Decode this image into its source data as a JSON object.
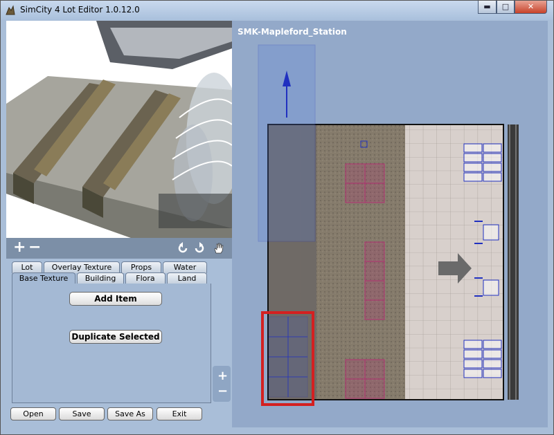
{
  "window": {
    "title": "SimCity 4 Lot Editor 1.0.12.0",
    "minimize_glyph": "▬",
    "maximize_glyph": "□",
    "close_glyph": "✕"
  },
  "toolbar": {
    "add_glyph": "+",
    "remove_glyph": "−",
    "icons": [
      "rotate-left-icon",
      "rotate-right-icon",
      "hand-pan-icon"
    ]
  },
  "tabs": {
    "row_top": [
      "Lot",
      "Overlay Texture",
      "Props",
      "Water"
    ],
    "row_bottom": [
      "Base Texture",
      "Building",
      "Flora",
      "Land"
    ],
    "active": "Base Texture"
  },
  "panel": {
    "add_item_label": "Add Item",
    "duplicate_label": "Duplicate Selected"
  },
  "zoom": {
    "in_glyph": "+",
    "out_glyph": "−"
  },
  "bottom_buttons": [
    "Open",
    "Save",
    "Save As",
    "Exit"
  ],
  "editor": {
    "lot_name": "SMK-Mapleford_Station",
    "colors": {
      "background": "#93a9c9",
      "selection_box": "#d42020",
      "overlay_blue": "#2030c0",
      "overlay_magenta": "#b03070"
    }
  }
}
